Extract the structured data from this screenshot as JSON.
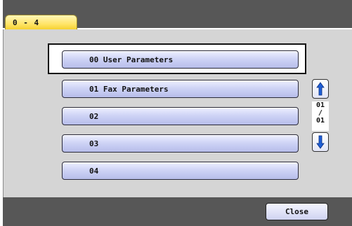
{
  "tab": {
    "label": "0 - 4"
  },
  "menu": {
    "items": [
      {
        "label": "00  User Parameters",
        "selected": true
      },
      {
        "label": "01  Fax Parameters",
        "selected": false
      },
      {
        "label": "02",
        "selected": false
      },
      {
        "label": "03",
        "selected": false
      },
      {
        "label": "04",
        "selected": false
      }
    ]
  },
  "pager": {
    "current": "01",
    "separator": "/",
    "total": "01"
  },
  "buttons": {
    "close_label": "Close"
  },
  "icons": {
    "up": "arrow-up-icon",
    "down": "arrow-down-icon"
  },
  "colors": {
    "tab": "#ffe466",
    "item": "#c6ccf1",
    "bars": "#575757",
    "panel": "#d5d5d5",
    "arrow": "#1f5fd6"
  }
}
